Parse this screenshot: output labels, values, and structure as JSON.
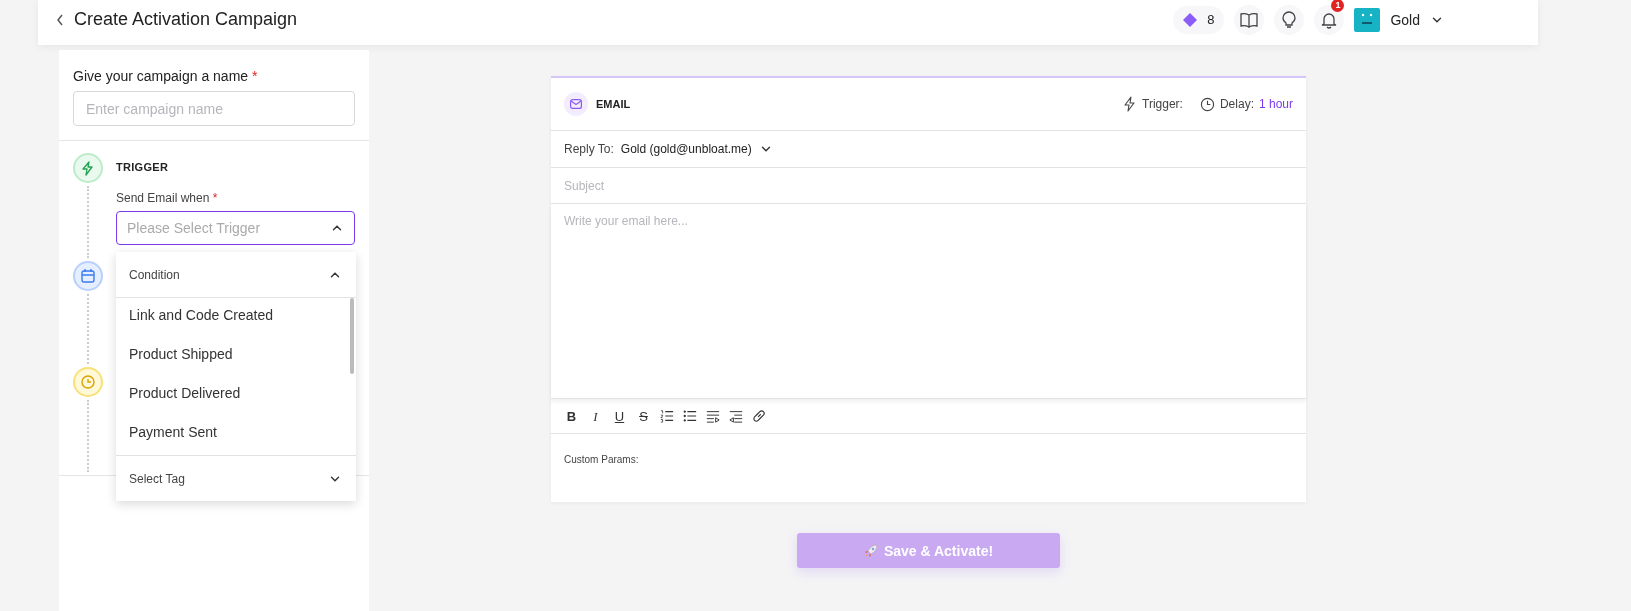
{
  "header": {
    "title": "Create Activation Campaign",
    "credits": "8",
    "notifications": "1",
    "user": "Gold"
  },
  "campaign_name": {
    "label": "Give your campaign a name",
    "required_mark": "*",
    "placeholder": "Enter campaign name"
  },
  "steps": [
    {
      "kind": "trigger",
      "title": "TRIGGER"
    },
    {
      "kind": "schedule"
    },
    {
      "kind": "delay"
    }
  ],
  "trigger_field": {
    "label": "Send Email when",
    "required_mark": "*",
    "placeholder": "Please Select Trigger",
    "open": true
  },
  "dropdown": {
    "groups": [
      {
        "title": "Condition",
        "expanded": true,
        "options": [
          "Link and Code Created",
          "Product Shipped",
          "Product Delivered",
          "Payment Sent"
        ]
      },
      {
        "title": "Select Tag",
        "expanded": false
      }
    ]
  },
  "email": {
    "channel": "EMAIL",
    "trigger_label": "Trigger:",
    "delay_label": "Delay:",
    "delay_value": "1 hour",
    "reply_to_label": "Reply To:",
    "reply_to": "Gold (gold@unbloat.me)",
    "subject_placeholder": "Subject",
    "body_placeholder": "Write your email here...",
    "toolbar": [
      {
        "kind": "bold",
        "label": "B"
      },
      {
        "kind": "italic",
        "label": "I"
      },
      {
        "kind": "underline",
        "label": "U"
      },
      {
        "kind": "strike",
        "label": "S"
      },
      {
        "kind": "ordered-list"
      },
      {
        "kind": "bullet-list"
      },
      {
        "kind": "indent"
      },
      {
        "kind": "outdent"
      },
      {
        "kind": "link"
      }
    ],
    "custom_params": "Custom Params:"
  },
  "save_button": {
    "label": "Save & Activate!",
    "disabled": true
  }
}
